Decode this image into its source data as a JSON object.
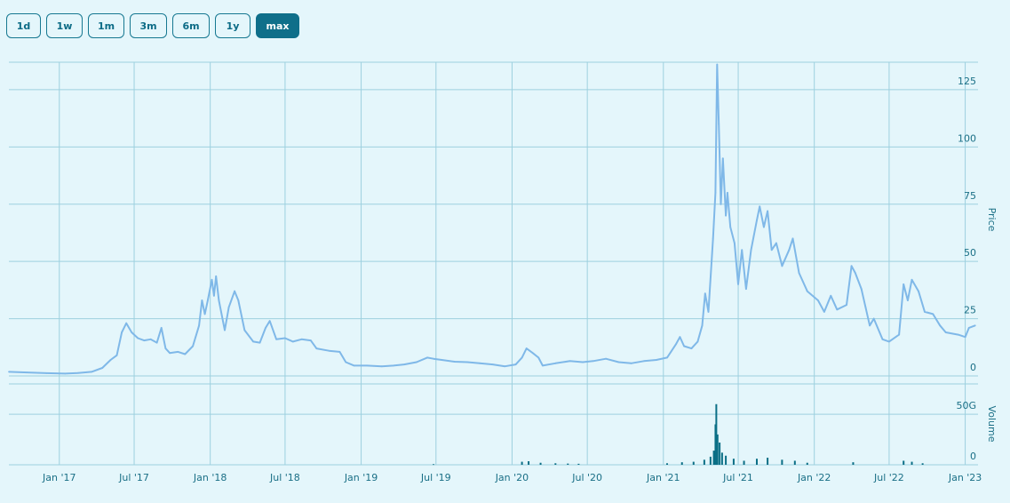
{
  "range_buttons": [
    {
      "label": "1d",
      "active": false
    },
    {
      "label": "1w",
      "active": false
    },
    {
      "label": "1m",
      "active": false
    },
    {
      "label": "3m",
      "active": false
    },
    {
      "label": "6m",
      "active": false
    },
    {
      "label": "1y",
      "active": false
    },
    {
      "label": "max",
      "active": true
    }
  ],
  "colors": {
    "background": "#e4f6fb",
    "grid": "#9dd0df",
    "price_line": "#7fb8e8",
    "volume_bars": "#0b6f86",
    "axis_text": "#1a6f86",
    "active_button": "#0f6f8a"
  },
  "chart_data": {
    "type": "line",
    "x_axis": {
      "type": "date",
      "range": [
        "2016-09-01",
        "2023-02-01"
      ],
      "tick_labels": [
        {
          "date": "2017-01-01",
          "label": "Jan '17"
        },
        {
          "date": "2017-07-01",
          "label": "Jul '17"
        },
        {
          "date": "2018-01-01",
          "label": "Jan '18"
        },
        {
          "date": "2018-07-01",
          "label": "Jul '18"
        },
        {
          "date": "2019-01-01",
          "label": "Jan '19"
        },
        {
          "date": "2019-07-01",
          "label": "Jul '19"
        },
        {
          "date": "2020-01-01",
          "label": "Jan '20"
        },
        {
          "date": "2020-07-01",
          "label": "Jul '20"
        },
        {
          "date": "2021-01-01",
          "label": "Jan '21"
        },
        {
          "date": "2021-07-01",
          "label": "Jul '21"
        },
        {
          "date": "2022-01-01",
          "label": "Jan '22"
        },
        {
          "date": "2022-07-01",
          "label": "Jul '22"
        },
        {
          "date": "2023-01-01",
          "label": "Jan '23"
        }
      ]
    },
    "price_panel": {
      "ylabel": "Price",
      "ylim": [
        0,
        137
      ],
      "ticks": [
        {
          "value": 0,
          "label": "0"
        },
        {
          "value": 25,
          "label": "25"
        },
        {
          "value": 50,
          "label": "50"
        },
        {
          "value": 75,
          "label": "75"
        },
        {
          "value": 100,
          "label": "100"
        },
        {
          "value": 125,
          "label": "125"
        }
      ],
      "series": [
        {
          "points": [
            [
              "2016-09-01",
              1.8
            ],
            [
              "2016-10-15",
              1.5
            ],
            [
              "2016-12-01",
              1.2
            ],
            [
              "2017-01-15",
              1.0
            ],
            [
              "2017-02-15",
              1.3
            ],
            [
              "2017-03-20",
              1.8
            ],
            [
              "2017-04-15",
              3.5
            ],
            [
              "2017-05-05",
              7.0
            ],
            [
              "2017-05-20",
              9.0
            ],
            [
              "2017-06-01",
              19.0
            ],
            [
              "2017-06-12",
              23.0
            ],
            [
              "2017-06-25",
              19.0
            ],
            [
              "2017-07-10",
              16.5
            ],
            [
              "2017-07-25",
              15.5
            ],
            [
              "2017-08-10",
              16.0
            ],
            [
              "2017-08-25",
              14.5
            ],
            [
              "2017-09-05",
              21.0
            ],
            [
              "2017-09-15",
              12.0
            ],
            [
              "2017-09-25",
              10.0
            ],
            [
              "2017-10-15",
              10.5
            ],
            [
              "2017-11-01",
              9.5
            ],
            [
              "2017-11-20",
              13.0
            ],
            [
              "2017-12-05",
              22.0
            ],
            [
              "2017-12-12",
              33.0
            ],
            [
              "2017-12-19",
              27.0
            ],
            [
              "2017-12-26",
              33.0
            ],
            [
              "2018-01-05",
              42.0
            ],
            [
              "2018-01-10",
              35.0
            ],
            [
              "2018-01-15",
              43.5
            ],
            [
              "2018-01-22",
              33.0
            ],
            [
              "2018-02-05",
              20.0
            ],
            [
              "2018-02-15",
              30.0
            ],
            [
              "2018-03-01",
              37.0
            ],
            [
              "2018-03-10",
              33.0
            ],
            [
              "2018-03-25",
              20.0
            ],
            [
              "2018-04-15",
              15.0
            ],
            [
              "2018-05-01",
              14.5
            ],
            [
              "2018-05-15",
              21.0
            ],
            [
              "2018-05-25",
              24.0
            ],
            [
              "2018-06-10",
              16.0
            ],
            [
              "2018-07-01",
              16.5
            ],
            [
              "2018-07-20",
              15.0
            ],
            [
              "2018-08-10",
              16.0
            ],
            [
              "2018-09-01",
              15.5
            ],
            [
              "2018-09-15",
              12.0
            ],
            [
              "2018-10-15",
              11.0
            ],
            [
              "2018-11-10",
              10.5
            ],
            [
              "2018-11-25",
              6.0
            ],
            [
              "2018-12-15",
              4.5
            ],
            [
              "2019-01-15",
              4.5
            ],
            [
              "2019-02-20",
              4.2
            ],
            [
              "2019-03-20",
              4.5
            ],
            [
              "2019-04-15",
              5.0
            ],
            [
              "2019-05-15",
              6.0
            ],
            [
              "2019-06-10",
              8.0
            ],
            [
              "2019-06-25",
              7.5
            ],
            [
              "2019-07-15",
              7.0
            ],
            [
              "2019-08-15",
              6.2
            ],
            [
              "2019-09-15",
              6.0
            ],
            [
              "2019-10-15",
              5.5
            ],
            [
              "2019-11-15",
              5.0
            ],
            [
              "2019-12-15",
              4.2
            ],
            [
              "2020-01-10",
              5.0
            ],
            [
              "2020-01-25",
              8.0
            ],
            [
              "2020-02-05",
              12.0
            ],
            [
              "2020-02-20",
              10.0
            ],
            [
              "2020-03-05",
              8.0
            ],
            [
              "2020-03-15",
              4.5
            ],
            [
              "2020-04-15",
              5.5
            ],
            [
              "2020-05-20",
              6.5
            ],
            [
              "2020-06-20",
              6.0
            ],
            [
              "2020-07-15",
              6.5
            ],
            [
              "2020-08-15",
              7.5
            ],
            [
              "2020-09-15",
              6.0
            ],
            [
              "2020-10-15",
              5.5
            ],
            [
              "2020-11-15",
              6.5
            ],
            [
              "2020-12-15",
              7.0
            ],
            [
              "2021-01-10",
              8.0
            ],
            [
              "2021-02-01",
              14.0
            ],
            [
              "2021-02-10",
              17.0
            ],
            [
              "2021-02-20",
              13.0
            ],
            [
              "2021-03-10",
              12.0
            ],
            [
              "2021-03-25",
              15.0
            ],
            [
              "2021-04-05",
              22.0
            ],
            [
              "2021-04-12",
              36.0
            ],
            [
              "2021-04-20",
              28.0
            ],
            [
              "2021-05-01",
              60.0
            ],
            [
              "2021-05-07",
              80.0
            ],
            [
              "2021-05-11",
              136.0
            ],
            [
              "2021-05-15",
              110.0
            ],
            [
              "2021-05-20",
              75.0
            ],
            [
              "2021-05-25",
              95.0
            ],
            [
              "2021-06-01",
              70.0
            ],
            [
              "2021-06-05",
              80.0
            ],
            [
              "2021-06-12",
              65.0
            ],
            [
              "2021-06-22",
              58.0
            ],
            [
              "2021-07-01",
              40.0
            ],
            [
              "2021-07-10",
              55.0
            ],
            [
              "2021-07-20",
              38.0
            ],
            [
              "2021-08-01",
              55.0
            ],
            [
              "2021-08-15",
              68.0
            ],
            [
              "2021-08-22",
              74.0
            ],
            [
              "2021-09-01",
              65.0
            ],
            [
              "2021-09-10",
              72.0
            ],
            [
              "2021-09-20",
              55.0
            ],
            [
              "2021-10-01",
              58.0
            ],
            [
              "2021-10-15",
              48.0
            ],
            [
              "2021-11-01",
              55.0
            ],
            [
              "2021-11-10",
              60.0
            ],
            [
              "2021-11-25",
              45.0
            ],
            [
              "2021-12-15",
              37.0
            ],
            [
              "2022-01-10",
              33.0
            ],
            [
              "2022-01-25",
              28.0
            ],
            [
              "2022-02-10",
              35.0
            ],
            [
              "2022-02-25",
              29.0
            ],
            [
              "2022-03-20",
              31.0
            ],
            [
              "2022-04-01",
              48.0
            ],
            [
              "2022-04-10",
              45.0
            ],
            [
              "2022-04-25",
              38.0
            ],
            [
              "2022-05-05",
              30.0
            ],
            [
              "2022-05-15",
              22.0
            ],
            [
              "2022-05-25",
              25.0
            ],
            [
              "2022-06-15",
              16.0
            ],
            [
              "2022-07-01",
              15.0
            ],
            [
              "2022-07-25",
              18.0
            ],
            [
              "2022-08-05",
              40.0
            ],
            [
              "2022-08-15",
              33.0
            ],
            [
              "2022-08-25",
              42.0
            ],
            [
              "2022-09-10",
              37.0
            ],
            [
              "2022-09-25",
              28.0
            ],
            [
              "2022-10-15",
              27.0
            ],
            [
              "2022-11-01",
              22.0
            ],
            [
              "2022-11-15",
              19.0
            ],
            [
              "2022-12-15",
              18.0
            ],
            [
              "2023-01-01",
              17.0
            ],
            [
              "2023-01-10",
              21.0
            ],
            [
              "2023-01-25",
              22.0
            ]
          ]
        }
      ]
    },
    "volume_panel": {
      "ylabel": "Volume",
      "ylim": [
        0,
        80
      ],
      "ticks": [
        {
          "value": 0,
          "label": "0"
        },
        {
          "value": 50,
          "label": "50G"
        }
      ],
      "value_unit": "G",
      "series": [
        {
          "points": [
            [
              "2019-06-25",
              0.6
            ],
            [
              "2020-01-25",
              3.0
            ],
            [
              "2020-02-10",
              3.5
            ],
            [
              "2020-03-10",
              2.0
            ],
            [
              "2020-04-15",
              1.5
            ],
            [
              "2020-05-15",
              1.2
            ],
            [
              "2020-06-10",
              1.0
            ],
            [
              "2021-01-10",
              1.5
            ],
            [
              "2021-02-15",
              2.5
            ],
            [
              "2021-03-15",
              3.0
            ],
            [
              "2021-04-10",
              5.0
            ],
            [
              "2021-04-25",
              8.0
            ],
            [
              "2021-05-03",
              14.0
            ],
            [
              "2021-05-07",
              40.0
            ],
            [
              "2021-05-09",
              60.0
            ],
            [
              "2021-05-12",
              30.0
            ],
            [
              "2021-05-17",
              22.0
            ],
            [
              "2021-05-23",
              12.0
            ],
            [
              "2021-06-01",
              9.0
            ],
            [
              "2021-06-20",
              6.0
            ],
            [
              "2021-07-15",
              4.0
            ],
            [
              "2021-08-15",
              6.0
            ],
            [
              "2021-09-10",
              7.0
            ],
            [
              "2021-10-15",
              5.0
            ],
            [
              "2021-11-15",
              4.0
            ],
            [
              "2021-12-15",
              2.0
            ],
            [
              "2022-04-05",
              2.5
            ],
            [
              "2022-08-05",
              4.0
            ],
            [
              "2022-08-25",
              3.0
            ],
            [
              "2022-09-20",
              1.5
            ]
          ]
        }
      ]
    }
  }
}
